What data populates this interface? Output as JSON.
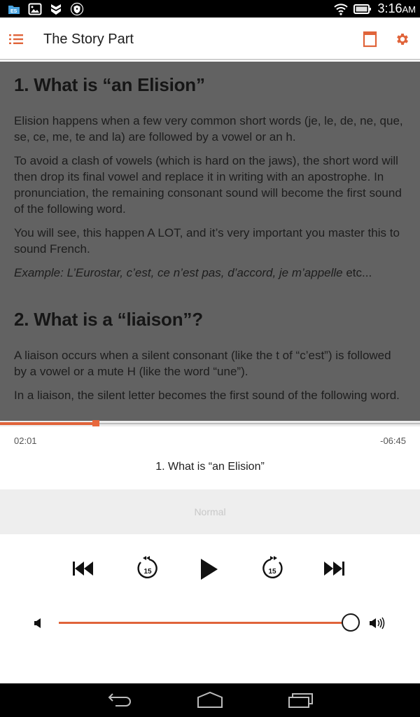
{
  "status_bar": {
    "time": "3:16",
    "ampm": "AM",
    "left_icons": [
      "es-file-explorer-icon",
      "gallery-icon",
      "app-shield-icon",
      "vpn-shield-icon"
    ],
    "right_icons": [
      "wifi-icon",
      "battery-icon"
    ]
  },
  "app_bar": {
    "title": "The Story Part",
    "menu_icon": "list-icon",
    "actions": [
      "book-icon",
      "gear-icon"
    ],
    "accent_color": "#E0643A"
  },
  "content": {
    "sections": [
      {
        "heading": "1. What is “an Elision”",
        "paragraphs": [
          "Elision happens when a few very common short words (je, le, de, ne, que, se, ce, me, te and la) are followed by a vowel or an h.",
          "To avoid a clash of vowels (which is hard on the jaws), the short word will then drop its final vowel and replace it in writing with an apostrophe. In pronunciation, the remaining consonant sound will become the first sound of the following word.",
          "You will see, this happen A LOT, and it’s very important you master this to sound French."
        ],
        "example_italic": "Example: L’Eurostar, c’est, ce n’est pas, d’accord, je m’appelle",
        "example_tail": " etc..."
      },
      {
        "heading": "2. What is a “liaison”?",
        "paragraphs": [
          "A liaison occurs when a silent consonant (like the t of “c’est”) is followed by a vowel or a mute H (like the word “une”).",
          "In a liaison, the silent letter becomes the first sound of the following word."
        ]
      }
    ]
  },
  "player": {
    "progress_fraction": 0.228,
    "elapsed": "02:01",
    "remaining": "-06:45",
    "track_title": "1. What is “an Elision”",
    "speed_label": "Normal",
    "controls": {
      "previous": "skip-previous-icon",
      "rewind": "replay-15-icon",
      "rewind_label": "15",
      "play": "play-icon",
      "forward": "forward-15-icon",
      "forward_label": "15",
      "next": "skip-next-icon"
    },
    "volume_fraction": 1.0
  },
  "nav_bar": {
    "buttons": [
      "back-icon",
      "home-icon",
      "recent-apps-icon"
    ]
  }
}
